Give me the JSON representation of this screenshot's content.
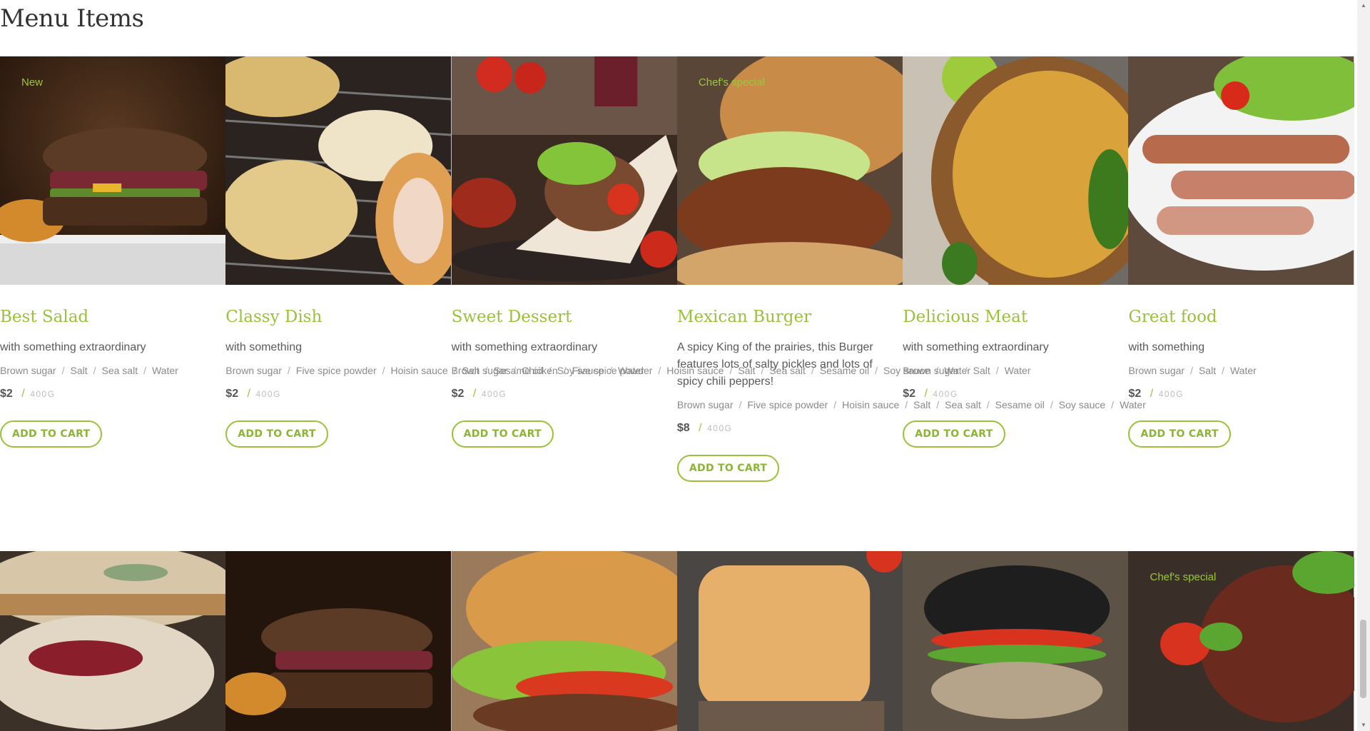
{
  "page": {
    "title": "Menu Items"
  },
  "items": [
    {
      "badge": "New",
      "name": "Best Salad",
      "description": "with something extraordinary",
      "ingredients": [
        "Brown sugar",
        "Salt",
        "Sea salt",
        "Water"
      ],
      "price": "$2",
      "weight": "400G",
      "button": "ADD TO CART"
    },
    {
      "badge": "",
      "name": "Classy Dish",
      "description": "with something",
      "ingredients": [
        "Brown sugar",
        "Five spice powder",
        "Hoisin sauce",
        "Salt",
        "Sesame oil",
        "Soy sauce",
        "Water"
      ],
      "price": "$2",
      "weight": "400G",
      "button": "ADD TO CART"
    },
    {
      "badge": "",
      "name": "Sweet Dessert",
      "description": "with something extraordinary",
      "ingredients": [
        "Brown sugar",
        "Chicken",
        "Five spice powder",
        "Hoisin sauce",
        "Salt",
        "Sea salt",
        "Sesame oil",
        "Soy sauce",
        "Water"
      ],
      "price": "$2",
      "weight": "400G",
      "button": "ADD TO CART"
    },
    {
      "badge": "Chef's special",
      "name": "Mexican Burger",
      "description": "A spicy King of the prairies, this Burger features lots of salty pickles and lots of spicy chili peppers!",
      "ingredients": [
        "Brown sugar",
        "Five spice powder",
        "Hoisin sauce",
        "Salt",
        "Sea salt",
        "Sesame oil",
        "Soy sauce",
        "Water"
      ],
      "price": "$8",
      "weight": "400G",
      "button": "ADD TO CART"
    },
    {
      "badge": "",
      "name": "Delicious Meat",
      "description": "with something extraordinary",
      "ingredients": [
        "Brown sugar",
        "Salt",
        "Water"
      ],
      "price": "$2",
      "weight": "400G",
      "button": "ADD TO CART"
    },
    {
      "badge": "",
      "name": "Great food",
      "description": "with something",
      "ingredients": [
        "Brown sugar",
        "Salt",
        "Water"
      ],
      "price": "$2",
      "weight": "400G",
      "button": "ADD TO CART"
    }
  ],
  "row2_badges": [
    "",
    "",
    "",
    "",
    "",
    "Chef's special"
  ],
  "colors": {
    "accent": "#99c23a",
    "text": "#555555",
    "muted": "#8a8a8a"
  }
}
